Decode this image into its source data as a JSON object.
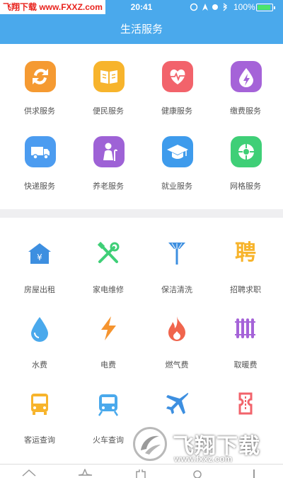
{
  "status": {
    "watermark": "飞翔下载 www.FXXZ.com",
    "time": "20:41",
    "battery": "100%"
  },
  "header": {
    "title": "生活服务"
  },
  "apps": [
    {
      "label": "供求服务",
      "icon": "refresh-icon",
      "color": "#f59a32"
    },
    {
      "label": "便民服务",
      "icon": "book-icon",
      "color": "#f7b42c"
    },
    {
      "label": "健康服务",
      "icon": "heart-pulse-icon",
      "color": "#f2636b"
    },
    {
      "label": "缴费服务",
      "icon": "drop-bolt-icon",
      "color": "#a563d8"
    },
    {
      "label": "快递服务",
      "icon": "truck-icon",
      "color": "#4c9cf0"
    },
    {
      "label": "养老服务",
      "icon": "elder-icon",
      "color": "#9e62d6"
    },
    {
      "label": "就业服务",
      "icon": "graduation-cap-icon",
      "color": "#3e9bec"
    },
    {
      "label": "网格服务",
      "icon": "globe-icon",
      "color": "#3fcf77"
    }
  ],
  "services": [
    {
      "label": "房屋出租",
      "icon": "house-yuan-icon",
      "color": "#3d8fe0"
    },
    {
      "label": "家电维修",
      "icon": "tools-icon",
      "color": "#3fcf77"
    },
    {
      "label": "保洁清洗",
      "icon": "broom-icon",
      "color": "#3d8fe0"
    },
    {
      "label": "招聘求职",
      "icon": "recruit-icon",
      "glyph": "聘",
      "color": "#f7b42c"
    },
    {
      "label": "水费",
      "icon": "water-drop-icon",
      "color": "#4aa9ec"
    },
    {
      "label": "电费",
      "icon": "lightning-icon",
      "color": "#f5942f"
    },
    {
      "label": "燃气费",
      "icon": "flame-icon",
      "color": "#f0654d"
    },
    {
      "label": "取暖费",
      "icon": "radiator-icon",
      "color": "#a563d8"
    },
    {
      "label": "客运查询",
      "icon": "bus-icon",
      "color": "#f7b42c"
    },
    {
      "label": "火车查询",
      "icon": "train-icon",
      "color": "#4aa9ec"
    },
    {
      "label": "",
      "icon": "airplane-icon",
      "color": "#3d8fe0"
    },
    {
      "label": "",
      "icon": "ticket-icon",
      "color": "#f2636b"
    }
  ],
  "brand": {
    "cn": "飞翔下载",
    "en": "www.fxxz.com"
  }
}
